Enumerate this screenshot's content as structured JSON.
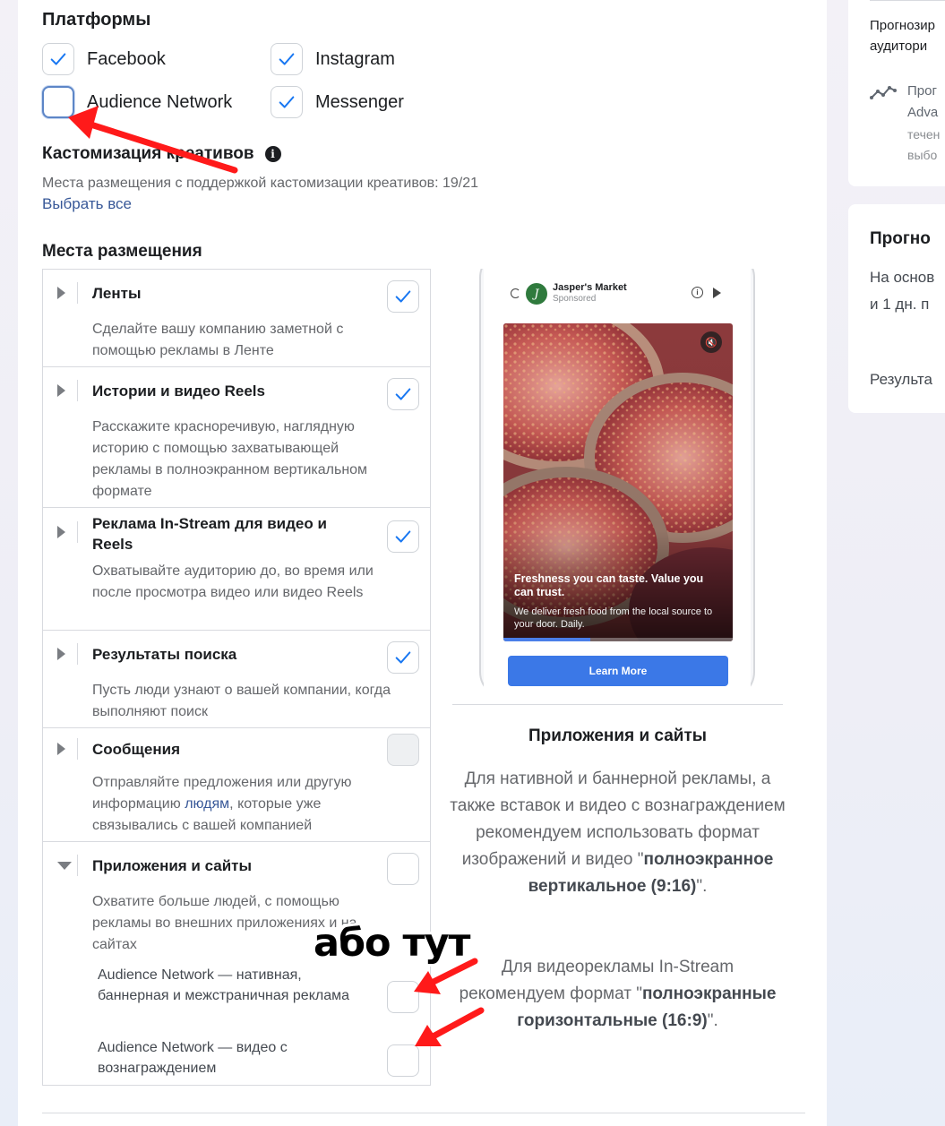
{
  "platforms": {
    "title": "Платформы",
    "items": [
      {
        "label": "Facebook",
        "checked": true
      },
      {
        "label": "Instagram",
        "checked": true
      },
      {
        "label": "Audience Network",
        "checked": false
      },
      {
        "label": "Messenger",
        "checked": true
      }
    ]
  },
  "customization": {
    "title": "Кастомизация креативов",
    "subtitle": "Места размещения с поддержкой кастомизации креативов: 19/21",
    "select_all": "Выбрать все"
  },
  "placements": {
    "title": "Места размещения",
    "rows": [
      {
        "title": "Ленты",
        "desc": "Сделайте вашу компанию заметной с помощью рекламы в Ленте",
        "checked": true
      },
      {
        "title": "Истории и видео Reels",
        "desc": "Расскажите красноречивую, наглядную историю с помощью захватывающей рекламы в полноэкранном вертикальном формате",
        "checked": true
      },
      {
        "title": "Реклама In-Stream для видео и Reels",
        "desc": "Охватывайте аудиторию до, во время или после просмотра видео или видео Reels",
        "checked": true
      },
      {
        "title": "Результаты поиска",
        "desc": "Пусть люди узнают о вашей компании, когда выполняют поиск",
        "checked": true
      },
      {
        "title": "Сообщения",
        "desc_before": "Отправляйте предложения или другую информацию",
        "desc_link": "людям",
        "desc_after": ", которые уже связывались с вашей компанией",
        "checked": false,
        "disabled": true
      },
      {
        "title": "Приложения и сайты",
        "desc": "Охватите больше людей, с помощью рекламы во внешних приложениях и на сайтах",
        "checked": false,
        "expanded": true,
        "sub_options": [
          {
            "label": "Audience Network — нативная, баннерная и межстраничная реклама",
            "checked": false
          },
          {
            "label": "Audience Network — видео с вознаграждением",
            "checked": false
          }
        ]
      }
    ]
  },
  "preview": {
    "ad": {
      "advertiser": "Jasper's Market",
      "avatar_letter": "J",
      "sponsored": "Sponsored",
      "headline": "Freshness you can taste. Value you can trust.",
      "text": "We deliver fresh food from the local source to your door. Daily.",
      "cta": "Learn More",
      "info_glyph": "i",
      "mute_glyph": "🔇"
    },
    "title": "Приложения и сайты",
    "desc1_before": "Для нативной и баннерной рекламы, а также вставок и видео с вознаграждением рекомендуем использовать формат изображений и видео \"",
    "desc1_bold": "полноэкранное вертикальное (9:16)",
    "desc1_after": "\".",
    "desc2_before": "Для видеорекламы In-Stream рекомендуем формат \"",
    "desc2_bold": "полноэкранные горизонтальные (16:9)",
    "desc2_after": "\"."
  },
  "right_panel": {
    "line1": "Прогнозир",
    "line2": "аудитори",
    "item_line1": "Прог",
    "item_line2": "Adva",
    "item_line3": "течен",
    "item_line4": "выбо",
    "card2_title": "Прогно",
    "card2_line1": "На основ",
    "card2_line2": "и 1 дн. п",
    "card2_line3": "Результа"
  },
  "annotation": {
    "text": "або тут",
    "arrow_color": "#ff0000"
  },
  "colors": {
    "check": "#1877f2",
    "link": "#385898",
    "cta": "#3b78e7"
  }
}
